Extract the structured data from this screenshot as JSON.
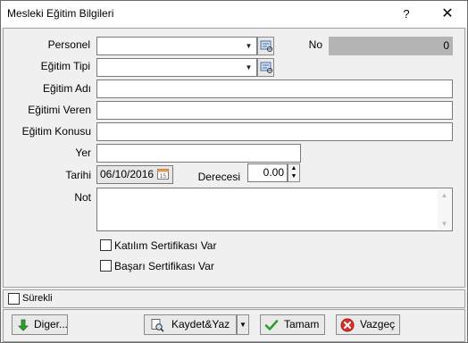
{
  "window": {
    "title": "Mesleki Eğitim Bilgileri",
    "help_label": "?",
    "close_label": "✕"
  },
  "form": {
    "personel_label": "Personel",
    "personel_value": "",
    "no_label": "No",
    "no_value": "0",
    "egitim_tipi_label": "Eğitim Tipi",
    "egitim_tipi_value": "",
    "egitim_adi_label": "Eğitim  Adı",
    "egitimi_veren_label": "Eğitimi Veren",
    "egitim_konusu_label": "Eğitim Konusu",
    "yer_label": "Yer",
    "tarihi_label": "Tarihi",
    "tarihi_value": "06/10/2016",
    "derecesi_label": "Derecesi",
    "derecesi_value": "0.00",
    "not_label": "Not",
    "katilim_label": "Katılım Sertifikası Var",
    "basari_label": "Başarı Sertifikası Var",
    "katilim_checked": false,
    "basari_checked": false
  },
  "footer": {
    "surekli_label": "Sürekli",
    "surekli_checked": false
  },
  "buttons": {
    "diger": "Diger...",
    "kaydet_yaz": "Kaydet&Yaz",
    "tamam": "Tamam",
    "vazgec": "Vazgeç"
  },
  "colors": {
    "accent_green": "#2e9e2e",
    "cancel_red": "#d9322b"
  }
}
